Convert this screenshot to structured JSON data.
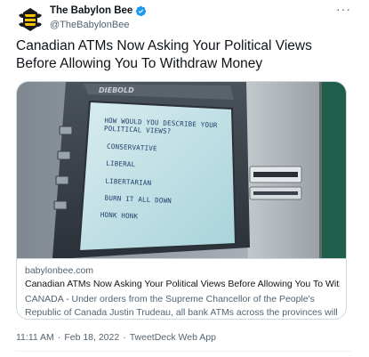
{
  "header": {
    "display_name": "The Babylon Bee",
    "handle": "@TheBabylonBee",
    "more_label": "···"
  },
  "tweet": {
    "text": "Canadian ATMs Now Asking Your Political Views Before Allowing You To Withdraw Money"
  },
  "card": {
    "image": {
      "atm_brand": "DIEBOLD",
      "screen_lines": [
        "HOW WOULD YOU DESCRIBE YOUR",
        "POLITICAL VIEWS?",
        "CONSERVATIVE",
        "LIBERAL",
        "LIBERTARIAN",
        "BURN IT ALL DOWN",
        "HONK HONK"
      ]
    },
    "domain": "babylonbee.com",
    "title": "Canadian ATMs Now Asking Your Political Views Before Allowing You To Withd...",
    "description": "CANADA - Under orders from the Supreme Chancellor of the People's Republic of Canada Justin Trudeau, all bank ATMs across the provinces will now require ..."
  },
  "meta": {
    "time": "11:11 AM",
    "separator_1": "·",
    "date": "Feb 18, 2022",
    "separator_2": "·",
    "source": "TweetDeck Web App"
  },
  "colors": {
    "text_primary": "#0f1419",
    "text_secondary": "#536471",
    "verified_blue": "#1d9bf0",
    "border": "#cfd9de"
  }
}
